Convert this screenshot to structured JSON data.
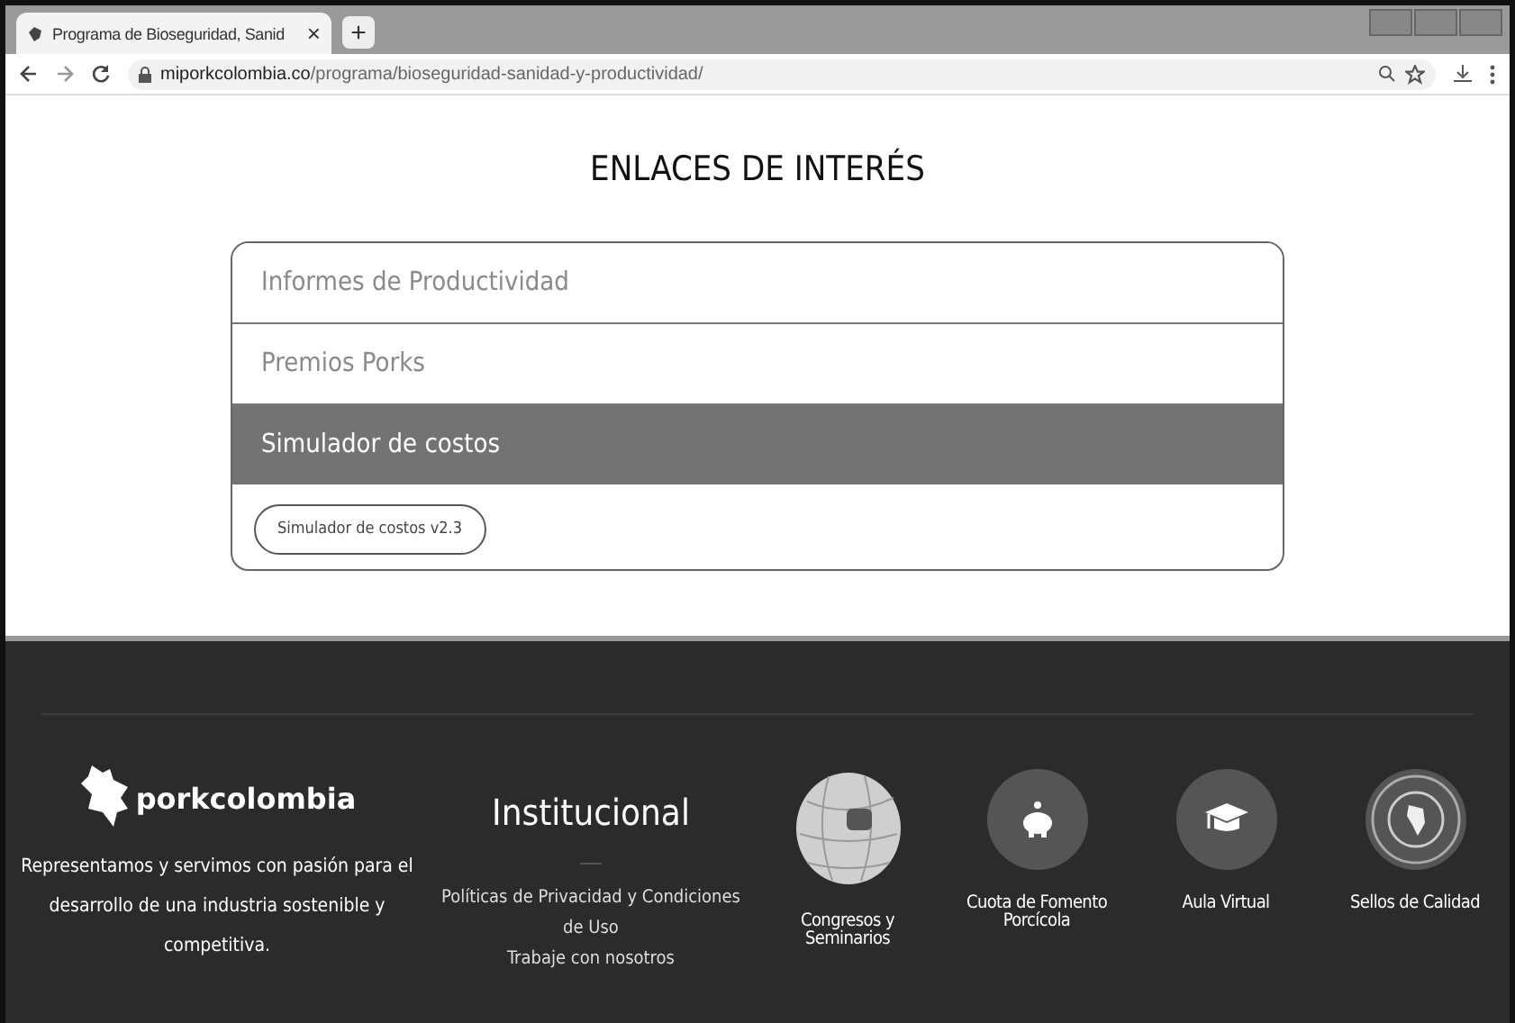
{
  "browser": {
    "tab_title": "Programa de Bioseguridad, Sanid",
    "tab_close": "×",
    "new_tab": "+",
    "url_domain": "miporkcolombia.co",
    "url_path": "/programa/bioseguridad-sanidad-y-productividad/"
  },
  "section_title": "ENLACES DE INTERÉS",
  "accordion": [
    {
      "label": "Informes de Productividad",
      "expanded": false
    },
    {
      "label": "Premios Porks",
      "expanded": false
    },
    {
      "label": "Simulador de costos",
      "expanded": true,
      "button": "Simulador de costos v2.3"
    }
  ],
  "footer": {
    "logo": "porkcolombia",
    "about": "Representamos y servimos con pasión para el desarrollo de una industria sostenible y competitiva.",
    "institutional_title": "Institucional",
    "institutional_links": [
      "Políticas de Privacidad y Condiciones de Uso",
      "Trabaje con nosotros"
    ],
    "shortcuts": [
      {
        "kind": "globe",
        "label": "Congresos y Seminarios"
      },
      {
        "kind": "piggy",
        "label": "Cuota de Fomento Porcícola"
      },
      {
        "kind": "cap",
        "label": "Aula Virtual"
      },
      {
        "kind": "seal",
        "label": "Sellos de Calidad"
      }
    ]
  }
}
